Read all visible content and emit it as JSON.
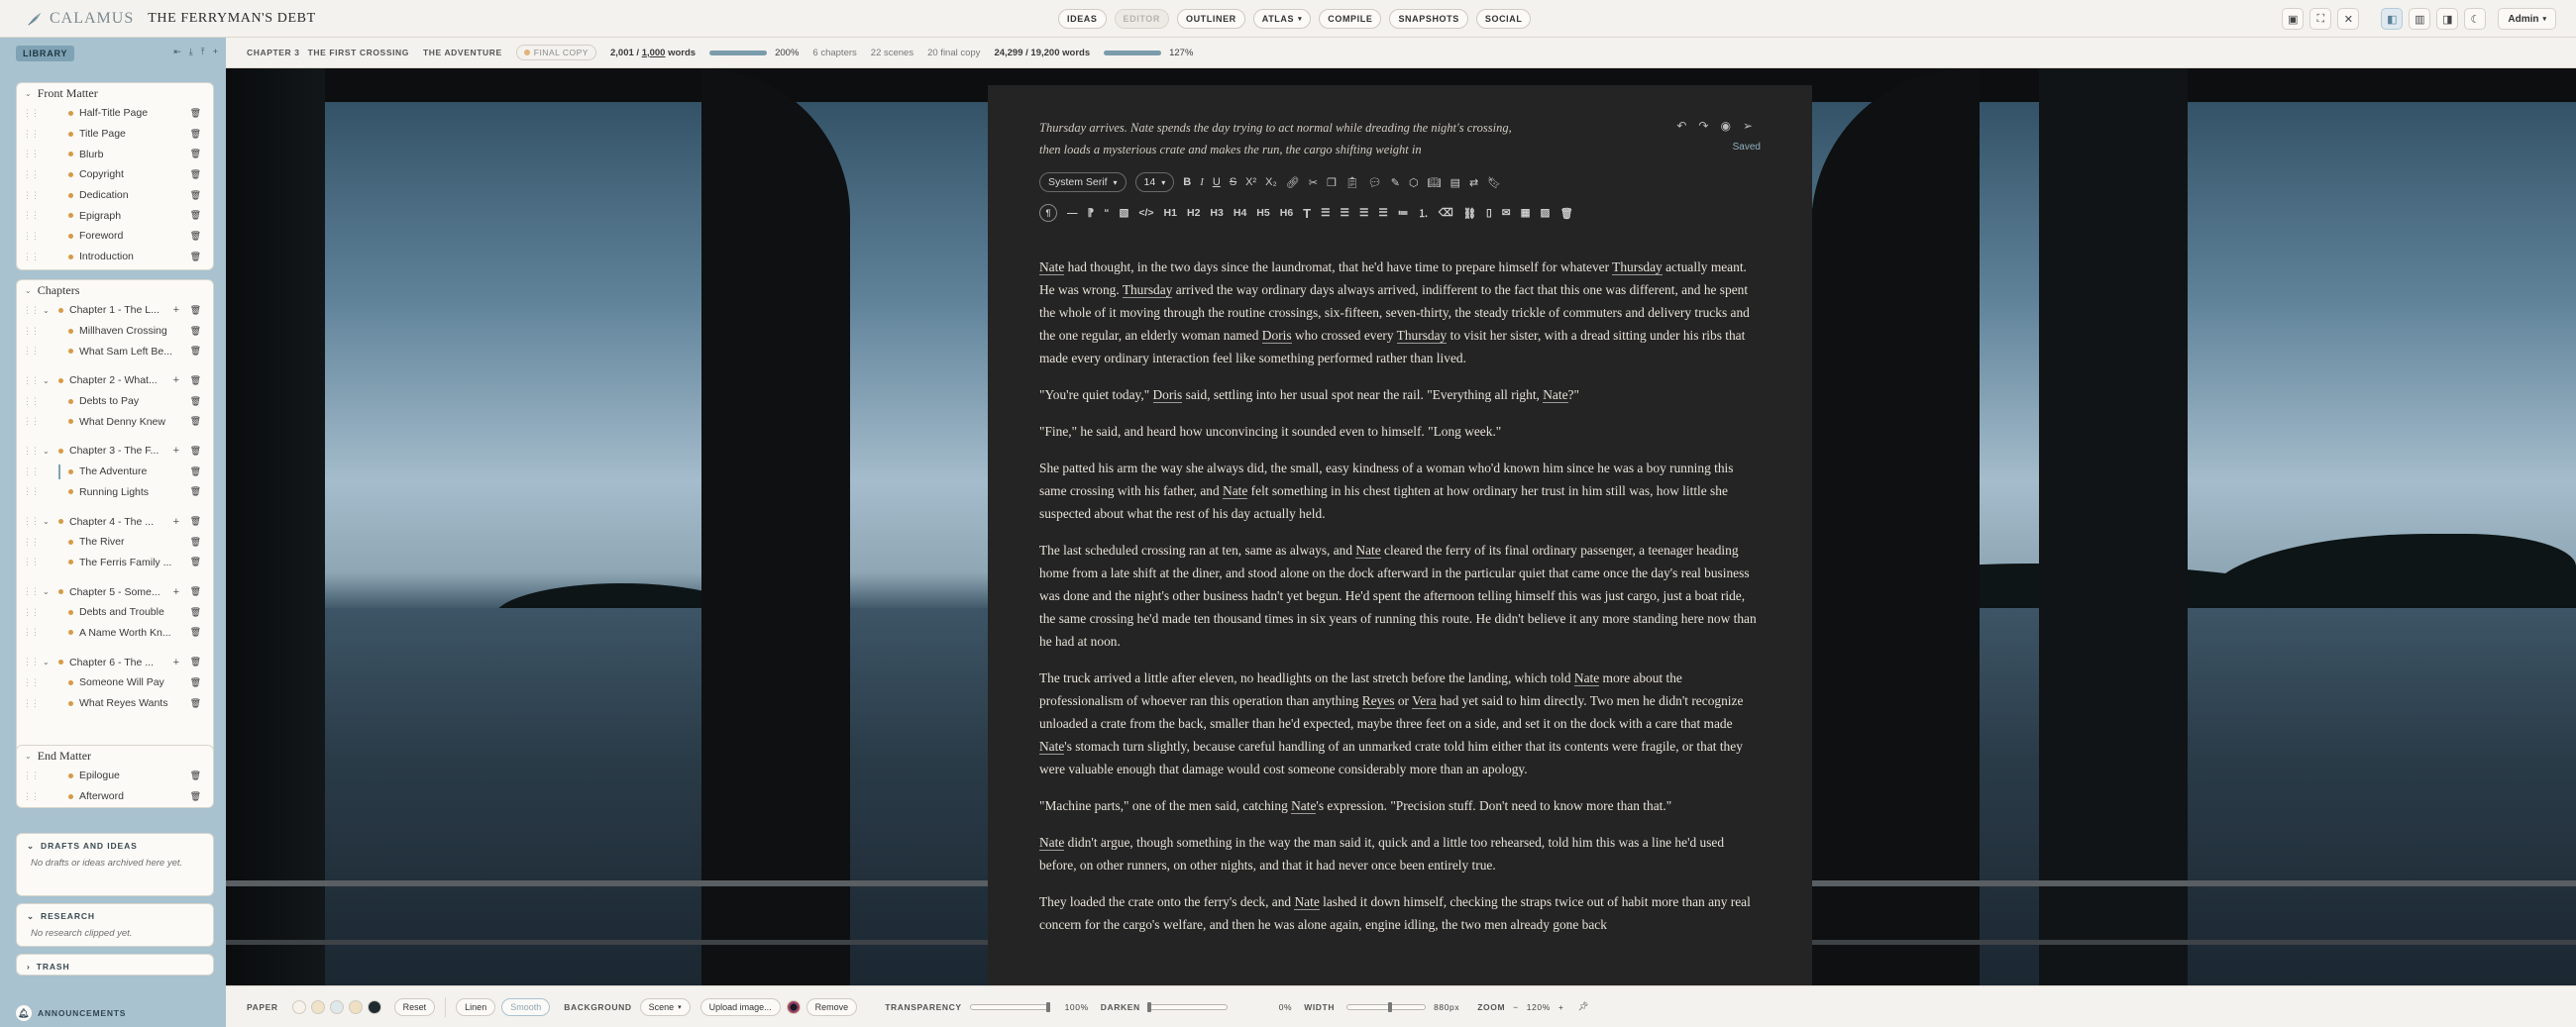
{
  "app": {
    "brand": "CALAMUS",
    "project": "THE FERRYMAN'S DEBT"
  },
  "nav": {
    "tabs": [
      {
        "label": "IDEAS",
        "active": false
      },
      {
        "label": "EDITOR",
        "active": true
      },
      {
        "label": "OUTLINER",
        "active": false
      },
      {
        "label": "ATLAS",
        "active": false,
        "dropdown": true
      },
      {
        "label": "COMPILE",
        "active": false
      },
      {
        "label": "SNAPSHOTS",
        "active": false
      },
      {
        "label": "SOCIAL",
        "active": false
      }
    ],
    "admin": "Admin"
  },
  "sidebar": {
    "library_label": "LIBRARY",
    "front_matter": {
      "title": "Front Matter",
      "items": [
        "Half-Title Page",
        "Title Page",
        "Blurb",
        "Copyright",
        "Dedication",
        "Epigraph",
        "Foreword",
        "Introduction"
      ]
    },
    "chapters": {
      "title": "Chapters",
      "groups": [
        {
          "title": "Chapter 1 - The L...",
          "scenes": [
            "Millhaven Crossing",
            "What Sam Left Be..."
          ]
        },
        {
          "title": "Chapter 2 - What...",
          "scenes": [
            "Debts to Pay",
            "What Denny Knew"
          ]
        },
        {
          "title": "Chapter 3 - The F...",
          "scenes": [
            "The Adventure",
            "Running Lights"
          ]
        },
        {
          "title": "Chapter 4 - The ...",
          "scenes": [
            "The River",
            "The Ferris Family ..."
          ]
        },
        {
          "title": "Chapter 5 - Some...",
          "scenes": [
            "Debts and Trouble",
            "A Name Worth Kn..."
          ]
        },
        {
          "title": "Chapter 6 - The ...",
          "scenes": [
            "Someone Will Pay",
            "What Reyes Wants"
          ]
        }
      ]
    },
    "end_matter": {
      "title": "End Matter",
      "items": [
        "Epilogue",
        "Afterword"
      ]
    },
    "drafts": {
      "title": "DRAFTS AND IDEAS",
      "empty": "No drafts or ideas archived here yet."
    },
    "research": {
      "title": "RESEARCH",
      "empty": "No research clipped yet."
    },
    "trash": {
      "title": "TRASH"
    },
    "announcements": "ANNOUNCEMENTS"
  },
  "stats": {
    "chapter": "CHAPTER 3",
    "chapter_title": "THE FIRST CROSSING",
    "scene": "THE ADVENTURE",
    "status": "FINAL COPY",
    "scene_words": "2,001",
    "scene_goal": "1,000",
    "words_label": "words",
    "scene_progress": 1.0,
    "scene_pct": "200%",
    "chapters": "6 chapters",
    "scenes": "22 scenes",
    "final": "20 final copy",
    "total_words": "24,299",
    "total_goal": "19,200",
    "total_progress": 1.0,
    "total_pct": "127%"
  },
  "editor": {
    "summary": "Thursday arrives. Nate spends the day trying to act normal while dreading the night's crossing, then loads a mysterious crate and makes the run, the cargo shifting weight in",
    "saved": "Saved",
    "font": "System Serif",
    "size": "14",
    "headings": [
      "H1",
      "H2",
      "H3",
      "H4",
      "H5",
      "H6"
    ],
    "paragraphs": [
      "Nate had thought, in the two days since the laundromat, that he'd have time to prepare himself for whatever Thursday actually meant. He was wrong. Thursday arrived the way ordinary days always arrived, indifferent to the fact that this one was different, and he spent the whole of it moving through the routine crossings, six-fifteen, seven-thirty, the steady trickle of commuters and delivery trucks and the one regular, an elderly woman named Doris who crossed every Thursday to visit her sister, with a dread sitting under his ribs that made every ordinary interaction feel like something performed rather than lived.",
      "\"You're quiet today,\" Doris said, settling into her usual spot near the rail. \"Everything all right, Nate?\"",
      "\"Fine,\" he said, and heard how unconvincing it sounded even to himself. \"Long week.\"",
      "She patted his arm the way she always did, the small, easy kindness of a woman who'd known him since he was a boy running this same crossing with his father, and Nate felt something in his chest tighten at how ordinary her trust in him still was, how little she suspected about what the rest of his day actually held.",
      "The last scheduled crossing ran at ten, same as always, and Nate cleared the ferry of its final ordinary passenger, a teenager heading home from a late shift at the diner, and stood alone on the dock afterward in the particular quiet that came once the day's real business was done and the night's other business hadn't yet begun. He'd spent the afternoon telling himself this was just cargo, just a boat ride, the same crossing he'd made ten thousand times in six years of running this route. He didn't believe it any more standing here now than he had at noon.",
      "The truck arrived a little after eleven, no headlights on the last stretch before the landing, which told Nate more about the professionalism of whoever ran this operation than anything Reyes or Vera had yet said to him directly. Two men he didn't recognize unloaded a crate from the back, smaller than he'd expected, maybe three feet on a side, and set it on the dock with a care that made Nate's stomach turn slightly, because careful handling of an unmarked crate told him either that its contents were fragile, or that they were valuable enough that damage would cost someone considerably more than an apology.",
      "\"Machine parts,\" one of the men said, catching Nate's expression. \"Precision stuff. Don't need to know more than that.\"",
      "Nate didn't argue, though something in the way the man said it, quick and a little too rehearsed, told him this was a line he'd used before, on other runners, on other nights, and that it had never once been entirely true.",
      "They loaded the crate onto the ferry's deck, and Nate lashed it down himself, checking the straps twice out of habit more than any real concern for the cargo's welfare, and then he was alone again, engine idling, the two men already gone back"
    ]
  },
  "bottom": {
    "paper": "PAPER",
    "reset": "Reset",
    "linen": "Linen",
    "smooth": "Smooth",
    "background": "BACKGROUND",
    "scene": "Scene",
    "upload": "Upload image...",
    "remove": "Remove",
    "transparency": "TRANSPARENCY",
    "transparency_value": "100%",
    "transparency_level": 1.0,
    "darken": "DARKEN",
    "darken_value": "0%",
    "darken_level": 0.0,
    "width": "WIDTH",
    "width_value": "880px",
    "width_level": 0.55,
    "zoom": "ZOOM",
    "zoom_value": "120%",
    "swatches": [
      "#f7f3ea",
      "#f1e3c8",
      "#dfe8ea",
      "#efe0c2",
      "#1f2a2e"
    ]
  },
  "colors": {
    "accent": "#7fa3b4",
    "sidebar": "#a8c2cf",
    "editor_bg": "#242424",
    "scene_dot": "#d79a46"
  }
}
